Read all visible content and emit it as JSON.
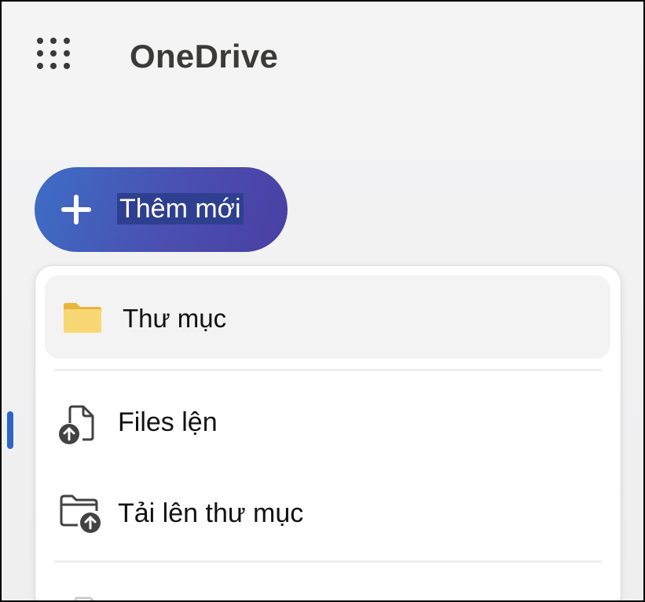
{
  "header": {
    "app_title": "OneDrive",
    "launcher_icon": "app-launcher-waffle-icon"
  },
  "new_button": {
    "label": "Thêm mới",
    "icon": "plus-icon"
  },
  "menu": {
    "items": [
      {
        "label": "Thư mục",
        "icon": "folder-icon",
        "hovered": true
      },
      {
        "label": "Files lện",
        "icon": "file-upload-icon"
      },
      {
        "label": "Tải lên thư mục",
        "icon": "folder-upload-icon"
      }
    ]
  },
  "colors": {
    "accent": "#2f63c6",
    "button_gradient_start": "#3d6ec6",
    "button_gradient_end": "#4a3fa3",
    "folder_yellow": "#f8d775",
    "folder_tab": "#e9b63c"
  }
}
